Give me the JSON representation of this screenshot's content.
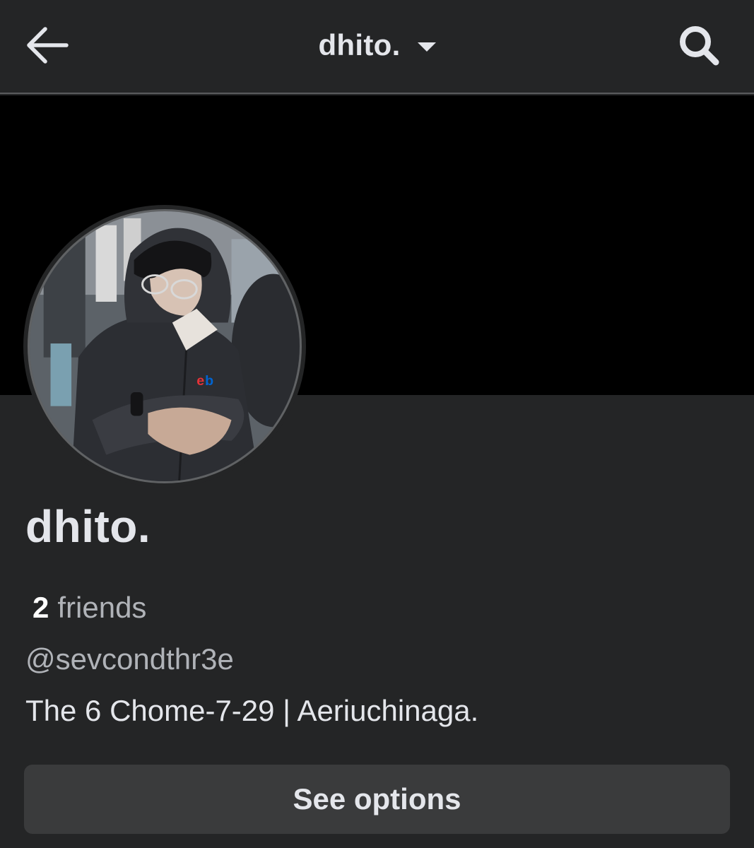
{
  "header": {
    "title": "dhito.",
    "back_icon": "arrow-left-icon",
    "dropdown_icon": "caret-down-icon",
    "search_icon": "search-icon"
  },
  "cover": {
    "color": "#000000"
  },
  "profile": {
    "name": "dhito.",
    "friends_count": "2",
    "friends_label": "friends",
    "handle": "@sevcondthr3e",
    "bio": "The 6 Chome-7-29 | Aeriuchinaga."
  },
  "actions": {
    "options_label": "See options"
  },
  "colors": {
    "background": "#242526",
    "text_primary": "#e4e6eb",
    "text_secondary": "#b0b3b8",
    "button_bg": "#3a3b3c"
  }
}
